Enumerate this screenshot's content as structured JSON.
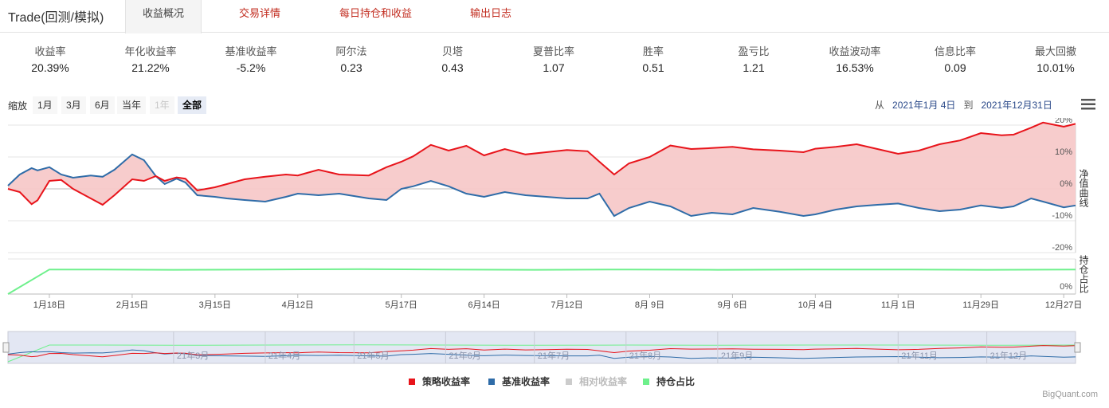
{
  "app_title": "Trade(回测/模拟)",
  "tabs": [
    {
      "label": "收益概况"
    },
    {
      "label": "交易详情"
    },
    {
      "label": "每日持仓和收益"
    },
    {
      "label": "输出日志"
    }
  ],
  "metrics": [
    {
      "label": "收益率",
      "value": "20.39%"
    },
    {
      "label": "年化收益率",
      "value": "21.22%"
    },
    {
      "label": "基准收益率",
      "value": "-5.2%"
    },
    {
      "label": "阿尔法",
      "value": "0.23"
    },
    {
      "label": "贝塔",
      "value": "0.43"
    },
    {
      "label": "夏普比率",
      "value": "1.07"
    },
    {
      "label": "胜率",
      "value": "0.51"
    },
    {
      "label": "盈亏比",
      "value": "1.21"
    },
    {
      "label": "收益波动率",
      "value": "16.53%"
    },
    {
      "label": "信息比率",
      "value": "0.09"
    },
    {
      "label": "最大回撤",
      "value": "10.01%"
    }
  ],
  "zoom": {
    "label": "缩放",
    "buttons": [
      "1月",
      "3月",
      "6月",
      "当年",
      "1年",
      "全部"
    ],
    "disabled": "1年",
    "selected": "全部"
  },
  "range": {
    "from_label": "从",
    "from": "2021年1月 4日",
    "to_label": "到",
    "to": "2021年12月31日"
  },
  "watermark": "BigQuant.com",
  "colors": {
    "strategy": "#e8141b",
    "benchmark": "#2f6ca8",
    "relative": "#cccccc",
    "position": "#6ef08c",
    "fill": "#f7c9c9"
  },
  "chart_data": {
    "type": "line",
    "x_range": [
      "2021-01-04",
      "2021-12-31"
    ],
    "ylim_returns": [
      -20,
      20
    ],
    "yticks_returns": [
      "20%",
      "10%",
      "0%",
      "-10%",
      "-20%"
    ],
    "ylim_position": [
      0,
      100
    ],
    "yticks_position": [
      "0%"
    ],
    "ylabel_returns": "净值曲线",
    "ylabel_position": "持仓占比",
    "xticks": [
      "1月18日",
      "2月15日",
      "3月15日",
      "4月12日",
      "5月17日",
      "6月14日",
      "7月12日",
      "8月 9日",
      "9月 6日",
      "10月 4日",
      "11月 1日",
      "11月29日",
      "12月27日"
    ],
    "navigator_labels": [
      "21年3月",
      "21年4月",
      "21年5月",
      "21年6月",
      "21年7月",
      "21年8月",
      "21年9月",
      "21年11月",
      "21年12月"
    ],
    "series": [
      {
        "name": "策略收益率",
        "x": [
          "2021-01-04",
          "2021-01-08",
          "2021-01-12",
          "2021-01-14",
          "2021-01-18",
          "2021-01-22",
          "2021-01-26",
          "2021-02-01",
          "2021-02-05",
          "2021-02-09",
          "2021-02-15",
          "2021-02-19",
          "2021-02-23",
          "2021-02-26",
          "2021-03-02",
          "2021-03-05",
          "2021-03-09",
          "2021-03-15",
          "2021-03-19",
          "2021-03-25",
          "2021-04-01",
          "2021-04-08",
          "2021-04-12",
          "2021-04-19",
          "2021-04-26",
          "2021-05-06",
          "2021-05-12",
          "2021-05-17",
          "2021-05-21",
          "2021-05-27",
          "2021-06-02",
          "2021-06-08",
          "2021-06-14",
          "2021-06-21",
          "2021-06-28",
          "2021-07-05",
          "2021-07-12",
          "2021-07-19",
          "2021-07-23",
          "2021-07-28",
          "2021-08-02",
          "2021-08-09",
          "2021-08-16",
          "2021-08-23",
          "2021-08-30",
          "2021-09-06",
          "2021-09-13",
          "2021-09-22",
          "2021-09-30",
          "2021-10-04",
          "2021-10-11",
          "2021-10-18",
          "2021-10-25",
          "2021-11-01",
          "2021-11-08",
          "2021-11-15",
          "2021-11-22",
          "2021-11-29",
          "2021-12-06",
          "2021-12-10",
          "2021-12-16",
          "2021-12-20",
          "2021-12-27",
          "2021-12-31"
        ],
        "y": [
          0.0,
          -1.0,
          -4.8,
          -3.6,
          2.5,
          2.8,
          0.0,
          -3.0,
          -5.0,
          -2.0,
          3.0,
          2.5,
          4.0,
          2.5,
          3.6,
          3.2,
          -0.5,
          0.5,
          1.5,
          3.0,
          3.8,
          4.5,
          4.2,
          6.0,
          4.5,
          4.2,
          6.8,
          8.5,
          10.2,
          13.8,
          12.0,
          13.5,
          10.5,
          12.5,
          10.8,
          11.5,
          12.2,
          11.8,
          8.5,
          4.5,
          8.0,
          10.0,
          13.6,
          12.5,
          12.8,
          13.2,
          12.4,
          12.0,
          11.5,
          12.6,
          13.2,
          14.0,
          12.5,
          11.0,
          12.0,
          14.0,
          15.2,
          17.5,
          16.8,
          17.0,
          19.2,
          20.8,
          19.5,
          20.39
        ]
      },
      {
        "name": "基准收益率",
        "x": [
          "2021-01-04",
          "2021-01-08",
          "2021-01-12",
          "2021-01-14",
          "2021-01-18",
          "2021-01-22",
          "2021-01-26",
          "2021-02-01",
          "2021-02-05",
          "2021-02-09",
          "2021-02-15",
          "2021-02-19",
          "2021-02-23",
          "2021-02-26",
          "2021-03-02",
          "2021-03-05",
          "2021-03-09",
          "2021-03-15",
          "2021-03-19",
          "2021-03-25",
          "2021-04-01",
          "2021-04-08",
          "2021-04-12",
          "2021-04-19",
          "2021-04-26",
          "2021-05-06",
          "2021-05-12",
          "2021-05-17",
          "2021-05-21",
          "2021-05-27",
          "2021-06-02",
          "2021-06-08",
          "2021-06-14",
          "2021-06-21",
          "2021-06-28",
          "2021-07-05",
          "2021-07-12",
          "2021-07-19",
          "2021-07-23",
          "2021-07-28",
          "2021-08-02",
          "2021-08-09",
          "2021-08-16",
          "2021-08-23",
          "2021-08-30",
          "2021-09-06",
          "2021-09-13",
          "2021-09-22",
          "2021-09-30",
          "2021-10-04",
          "2021-10-11",
          "2021-10-18",
          "2021-10-25",
          "2021-11-01",
          "2021-11-08",
          "2021-11-15",
          "2021-11-22",
          "2021-11-29",
          "2021-12-06",
          "2021-12-10",
          "2021-12-16",
          "2021-12-20",
          "2021-12-27",
          "2021-12-31"
        ],
        "y": [
          1.0,
          4.5,
          6.5,
          5.8,
          6.8,
          4.5,
          3.5,
          4.2,
          3.8,
          6.0,
          10.8,
          9.0,
          4.0,
          1.5,
          3.2,
          2.0,
          -2.0,
          -2.5,
          -3.0,
          -3.5,
          -4.0,
          -2.5,
          -1.5,
          -2.0,
          -1.5,
          -3.0,
          -3.5,
          0.0,
          0.8,
          2.5,
          0.8,
          -1.5,
          -2.5,
          -1.0,
          -2.0,
          -2.5,
          -3.0,
          -3.0,
          -1.5,
          -8.5,
          -6.0,
          -4.0,
          -5.5,
          -8.5,
          -7.5,
          -8.0,
          -6.0,
          -7.2,
          -8.5,
          -8.0,
          -6.5,
          -5.5,
          -5.0,
          -4.6,
          -6.0,
          -7.0,
          -6.5,
          -5.2,
          -6.0,
          -5.5,
          -3.0,
          -4.0,
          -5.8,
          -5.2
        ]
      },
      {
        "name": "相对收益率",
        "x": [],
        "y": []
      },
      {
        "name": "持仓占比",
        "x": [
          "2021-01-04",
          "2021-01-18",
          "2021-02-01",
          "2021-03-01",
          "2021-04-01",
          "2021-05-03",
          "2021-06-01",
          "2021-07-01",
          "2021-08-02",
          "2021-09-01",
          "2021-10-08",
          "2021-11-01",
          "2021-12-01",
          "2021-12-31"
        ],
        "y": [
          0,
          70,
          70,
          69,
          70,
          71,
          70,
          69,
          70,
          69,
          70,
          70,
          69,
          70
        ]
      }
    ],
    "legend": [
      {
        "name": "策略收益率",
        "visible": true
      },
      {
        "name": "基准收益率",
        "visible": true
      },
      {
        "name": "相对收益率",
        "visible": false
      },
      {
        "name": "持仓占比",
        "visible": true
      }
    ]
  }
}
